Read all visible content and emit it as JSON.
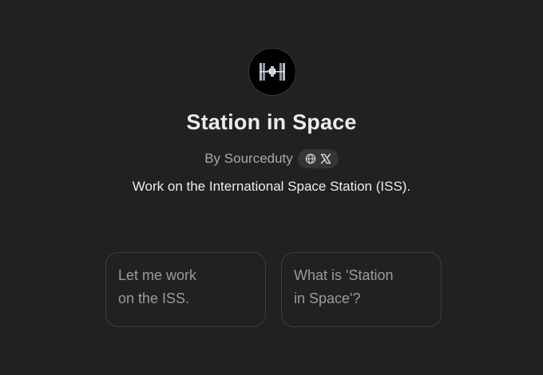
{
  "gpt": {
    "avatar_icon": "space-station-icon",
    "title": "Station in Space",
    "byline": "By Sourceduty",
    "social_icons": [
      "globe-icon",
      "x-logo-icon"
    ],
    "description": "Work on the International Space Station (ISS)."
  },
  "starters": [
    {
      "line1": "Let me work",
      "line2": "on the ISS."
    },
    {
      "line1": "What is 'Station",
      "line2": "in Space'?"
    }
  ],
  "colors": {
    "background": "#212121",
    "title": "#ececec",
    "muted": "#a8a8a8",
    "card_border": "#3d3d3d",
    "pill": "#353535"
  }
}
